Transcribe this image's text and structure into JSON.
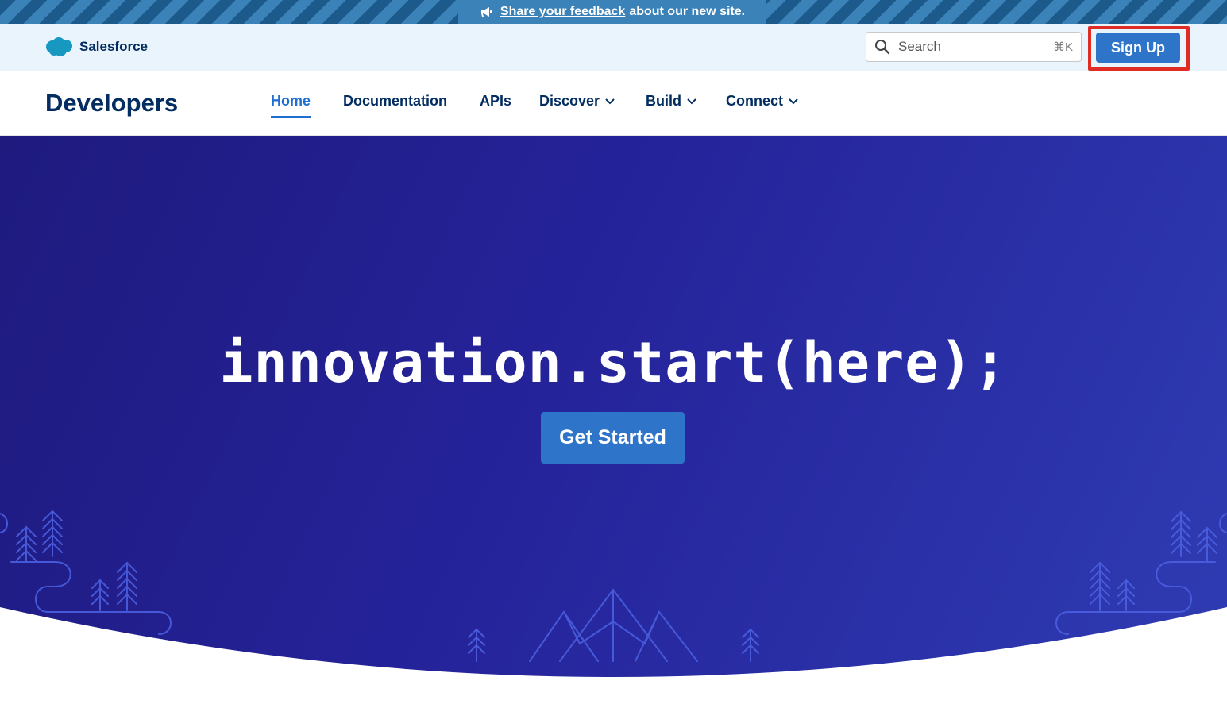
{
  "banner": {
    "link_text": "Share your feedback",
    "rest_text": "about our new site.",
    "icon": "megaphone-icon"
  },
  "topbar": {
    "brand_name": "Salesforce",
    "search": {
      "placeholder": "Search",
      "shortcut": "⌘K"
    },
    "signup_label": "Sign Up"
  },
  "nav": {
    "title": "Developers",
    "items": [
      {
        "label": "Home",
        "active": true
      },
      {
        "label": "Documentation"
      },
      {
        "label": "APIs"
      },
      {
        "label": "Discover",
        "dropdown": true
      },
      {
        "label": "Build",
        "dropdown": true
      },
      {
        "label": "Connect",
        "dropdown": true
      }
    ]
  },
  "hero": {
    "headline": "innovation.start(here);",
    "cta_label": "Get Started"
  },
  "colors": {
    "accent": "#2e74c9",
    "brand_dark": "#032d60",
    "hero_start": "#1e1a7e",
    "hero_end": "#2f3cb3",
    "highlight": "#e12b25"
  }
}
